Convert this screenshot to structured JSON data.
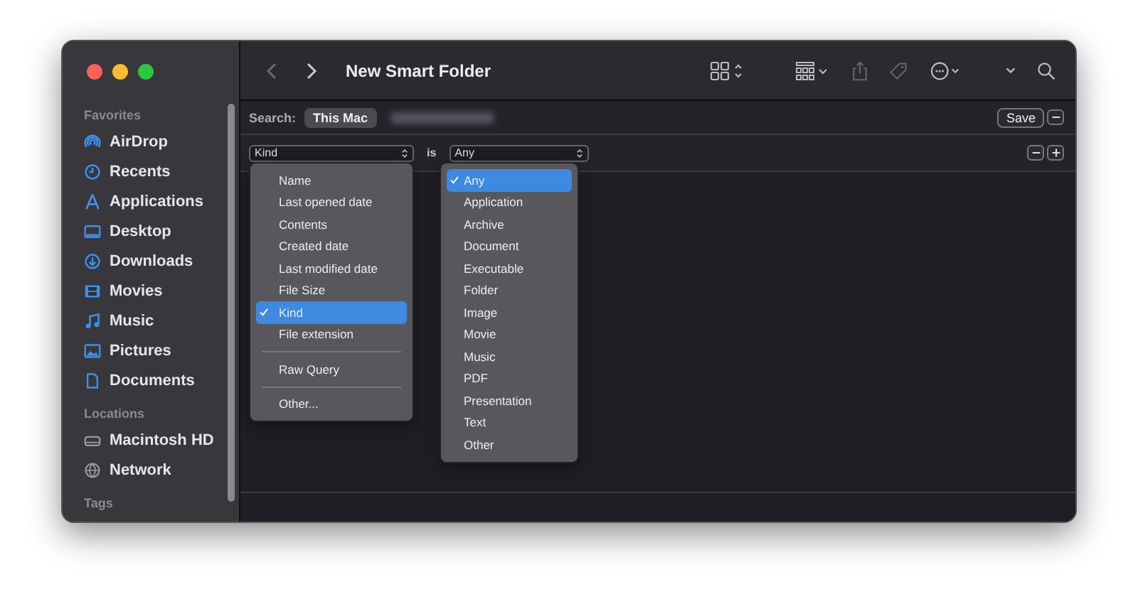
{
  "window": {
    "title": "New Smart Folder"
  },
  "sidebar": {
    "sections": [
      {
        "heading": "Favorites",
        "items": [
          {
            "label": "AirDrop"
          },
          {
            "label": "Recents"
          },
          {
            "label": "Applications"
          },
          {
            "label": "Desktop"
          },
          {
            "label": "Downloads"
          },
          {
            "label": "Movies"
          },
          {
            "label": "Music"
          },
          {
            "label": "Pictures"
          },
          {
            "label": "Documents"
          }
        ]
      },
      {
        "heading": "Locations",
        "items": [
          {
            "label": "Macintosh HD"
          },
          {
            "label": "Network"
          }
        ]
      },
      {
        "heading": "Tags"
      }
    ]
  },
  "search_bar": {
    "label": "Search:",
    "scope": "This Mac",
    "save": "Save"
  },
  "criteria": {
    "attribute": "Kind",
    "operator": "is",
    "value": "Any"
  },
  "attribute_menu": [
    {
      "kind": "item",
      "label": "Name",
      "checked": false
    },
    {
      "kind": "item",
      "label": "Last opened date",
      "checked": false
    },
    {
      "kind": "item",
      "label": "Contents",
      "checked": false
    },
    {
      "kind": "item",
      "label": "Created date",
      "checked": false
    },
    {
      "kind": "item",
      "label": "Last modified date",
      "checked": false
    },
    {
      "kind": "item",
      "label": "File Size",
      "checked": false
    },
    {
      "kind": "item",
      "label": "Kind",
      "checked": true
    },
    {
      "kind": "item",
      "label": "File extension",
      "checked": false
    },
    {
      "kind": "separator"
    },
    {
      "kind": "item",
      "label": "Raw Query",
      "checked": false
    },
    {
      "kind": "separator"
    },
    {
      "kind": "item",
      "label": "Other...",
      "checked": false
    }
  ],
  "value_menu": [
    {
      "label": "Any",
      "checked": true
    },
    {
      "label": "Application",
      "checked": false
    },
    {
      "label": "Archive",
      "checked": false
    },
    {
      "label": "Document",
      "checked": false
    },
    {
      "label": "Executable",
      "checked": false
    },
    {
      "label": "Folder",
      "checked": false
    },
    {
      "label": "Image",
      "checked": false
    },
    {
      "label": "Movie",
      "checked": false
    },
    {
      "label": "Music",
      "checked": false
    },
    {
      "label": "PDF",
      "checked": false
    },
    {
      "label": "Presentation",
      "checked": false
    },
    {
      "label": "Text",
      "checked": false
    },
    {
      "label": "Other",
      "checked": false
    }
  ]
}
